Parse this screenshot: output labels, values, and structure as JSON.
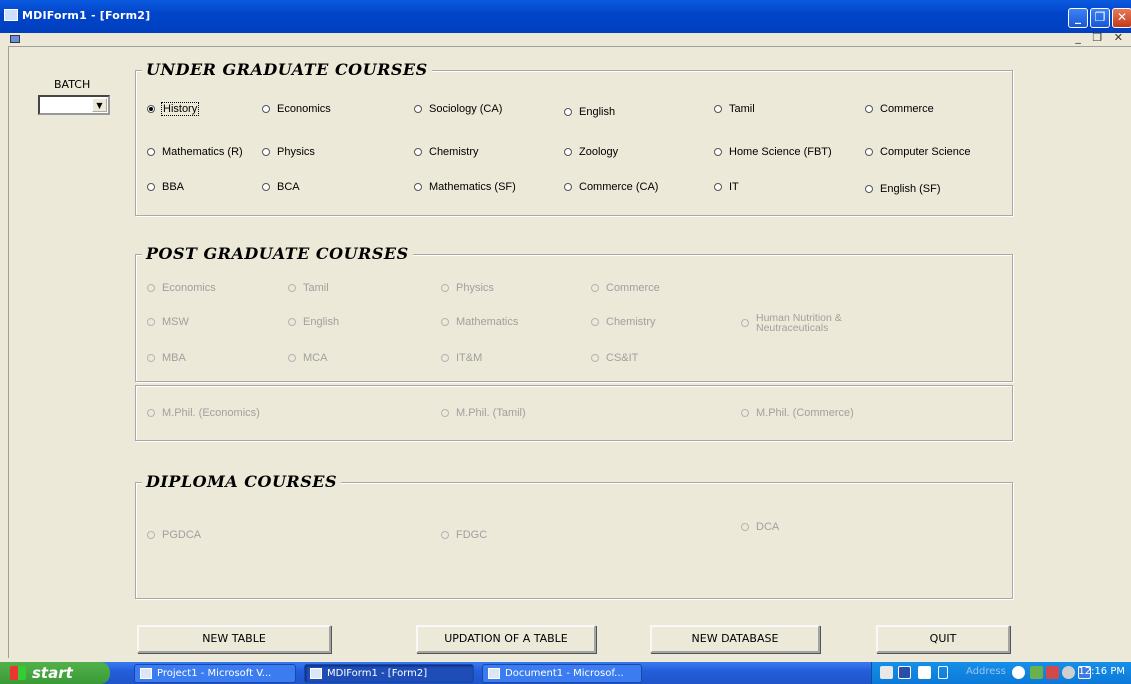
{
  "window": {
    "title": "MDIForm1 - [Form2]",
    "min": "_",
    "restore": "❐",
    "close": "✕",
    "mdi_controls": "_ ❐ ✕"
  },
  "batch": {
    "label": "BATCH",
    "arrow": "▼"
  },
  "ug": {
    "legend": "UNDER GRADUATE COURSES",
    "options": [
      "History",
      "Economics",
      "Sociology (CA)",
      "English",
      "Tamil",
      "Commerce",
      "Mathematics (R)",
      "Physics",
      "Chemistry",
      "Zoology",
      "Home Science (FBT)",
      "Computer Science",
      "BBA",
      "BCA",
      "Mathematics (SF)",
      "Commerce (CA)",
      "IT",
      "English (SF)"
    ]
  },
  "pg": {
    "legend": "POST GRADUATE COURSES",
    "options": [
      "Economics",
      "Tamil",
      "Physics",
      "Commerce",
      "MSW",
      "English",
      "Mathematics",
      "Chemistry",
      "Human Nutrition &\nNeutraceuticals",
      "MBA",
      "MCA",
      "IT&M",
      "CS&IT"
    ],
    "mphil": [
      "M.Phil. (Economics)",
      "M.Phil. (Tamil)",
      "M.Phil. (Commerce)"
    ]
  },
  "diploma": {
    "legend": "DIPLOMA COURSES",
    "options": [
      "PGDCA",
      "FDGC",
      "DCA"
    ]
  },
  "buttons": {
    "new_table": "NEW TABLE",
    "updation": "UPDATION OF A TABLE",
    "new_database": "NEW DATABASE",
    "quit": "QUIT"
  },
  "taskbar": {
    "start": "start",
    "tasks": [
      "Project1 - Microsoft V...",
      "MDIForm1 - [Form2]",
      "Document1 - Microsof..."
    ],
    "address": "Address",
    "clock": "12:16 PM"
  }
}
